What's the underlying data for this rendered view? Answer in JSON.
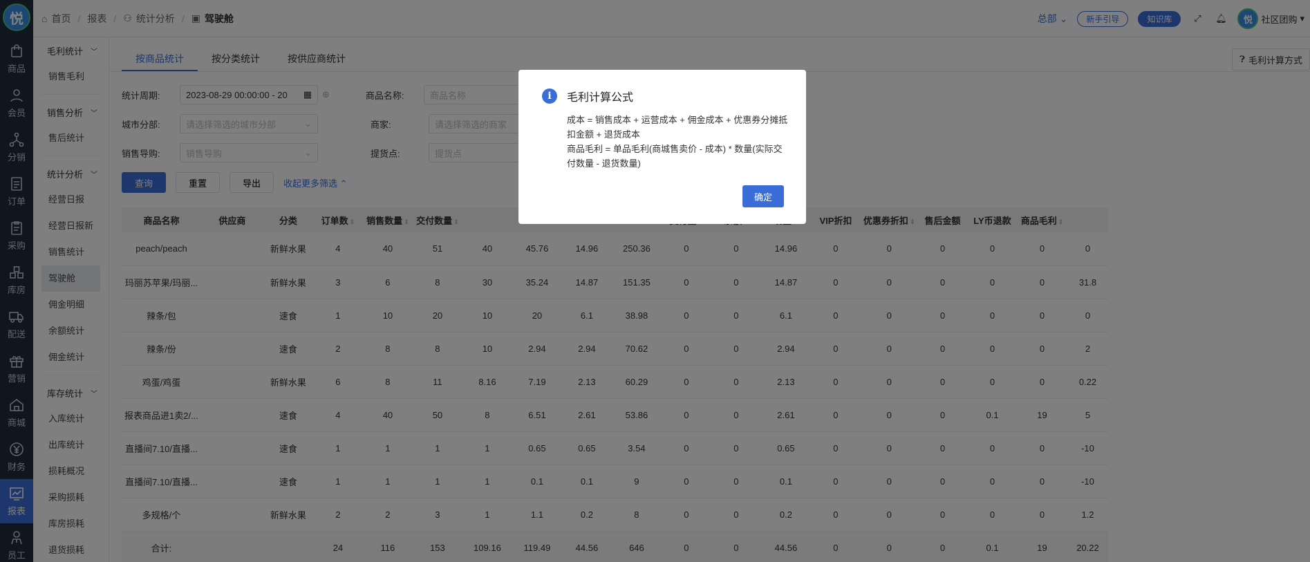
{
  "sidebar": {
    "logo": "悦",
    "items": [
      {
        "label": "商品",
        "icon": "bag-icon"
      },
      {
        "label": "会员",
        "icon": "user-icon"
      },
      {
        "label": "分销",
        "icon": "network-icon"
      },
      {
        "label": "订单",
        "icon": "document-icon"
      },
      {
        "label": "采购",
        "icon": "clipboard-icon"
      },
      {
        "label": "库房",
        "icon": "boxes-icon"
      },
      {
        "label": "配送",
        "icon": "truck-icon"
      },
      {
        "label": "营销",
        "icon": "gift-icon"
      },
      {
        "label": "商城",
        "icon": "home-icon"
      },
      {
        "label": "财务",
        "icon": "yen-icon"
      },
      {
        "label": "报表",
        "icon": "chart-icon"
      },
      {
        "label": "员工",
        "icon": "staff-icon"
      }
    ]
  },
  "submenu": {
    "group1": "毛利统计",
    "g1_items": [
      "销售毛利"
    ],
    "group2": "销售分析",
    "g2_items": [
      "售后统计"
    ],
    "group3": "统计分析",
    "g3_items": [
      "经营日报",
      "经营日报新",
      "销售统计",
      "驾驶舱",
      "佣金明细",
      "余额统计",
      "佣金统计"
    ],
    "group4": "库存统计",
    "g4_items": [
      "入库统计",
      "出库统计",
      "损耗概况",
      "采购损耗",
      "库房损耗",
      "退货损耗"
    ]
  },
  "header": {
    "breadcrumb": [
      "首页",
      "报表",
      "统计分析",
      "驾驶舱"
    ],
    "org": "总部",
    "guide": "新手引导",
    "kb": "知识库",
    "user": "社区团购",
    "avatar": "悦"
  },
  "tabs": [
    "按商品统计",
    "按分类统计",
    "按供应商统计"
  ],
  "calc_button": "毛利计算方式",
  "filters": {
    "period_label": "统计周期:",
    "period_value": "2023-08-29 00:00:00 - 20",
    "product_label": "商品名称:",
    "product_ph": "商品名称",
    "city_label": "城市分部:",
    "city_ph": "请选择筛选的城市分部",
    "merchant_label": "商家:",
    "merchant_ph": "请选择筛选的商家",
    "guide_label": "销售导购:",
    "guide_ph": "销售导购",
    "pickup_label": "提货点:",
    "pickup_ph": "提货点"
  },
  "buttons": {
    "query": "查询",
    "reset": "重置",
    "export": "导出",
    "more": "收起更多筛选"
  },
  "table": {
    "headers": [
      "商品名称",
      "供应商",
      "分类",
      "订单数",
      "销售数量",
      "交付数量",
      "",
      "",
      "",
      "",
      "支付宝",
      "余额",
      "现金",
      "VIP折扣",
      "优惠券折扣",
      "售后金额",
      "LY币退款",
      "商品毛利"
    ],
    "sortable": [
      false,
      false,
      false,
      true,
      true,
      true,
      false,
      false,
      false,
      false,
      true,
      true,
      true,
      false,
      true,
      false,
      false,
      true
    ],
    "rows": [
      [
        "peach/peach",
        "",
        "新鲜水果",
        "4",
        "40",
        "51",
        "40",
        "45.76",
        "14.96",
        "250.36",
        "0",
        "0",
        "14.96",
        "0",
        "0",
        "0",
        "0",
        "0",
        "0"
      ],
      [
        "玛丽苏苹果/玛丽...",
        "",
        "新鲜水果",
        "3",
        "6",
        "8",
        "30",
        "35.24",
        "14.87",
        "151.35",
        "0",
        "0",
        "14.87",
        "0",
        "0",
        "0",
        "0",
        "0",
        "31.8"
      ],
      [
        "辣条/包",
        "",
        "速食",
        "1",
        "10",
        "20",
        "10",
        "20",
        "6.1",
        "38.98",
        "0",
        "0",
        "6.1",
        "0",
        "0",
        "0",
        "0",
        "0",
        "0"
      ],
      [
        "辣条/份",
        "",
        "速食",
        "2",
        "8",
        "8",
        "10",
        "2.94",
        "2.94",
        "70.62",
        "0",
        "0",
        "2.94",
        "0",
        "0",
        "0",
        "0",
        "0",
        "2"
      ],
      [
        "鸡蛋/鸡蛋",
        "",
        "新鲜水果",
        "6",
        "8",
        "11",
        "8.16",
        "7.19",
        "2.13",
        "60.29",
        "0",
        "0",
        "2.13",
        "0",
        "0",
        "0",
        "0",
        "0",
        "0.22"
      ],
      [
        "报表商品进1卖2/...",
        "",
        "速食",
        "4",
        "40",
        "50",
        "8",
        "6.51",
        "2.61",
        "53.86",
        "0",
        "0",
        "2.61",
        "0",
        "0",
        "0",
        "0.1",
        "19",
        "5"
      ],
      [
        "直播间7.10/直播...",
        "",
        "速食",
        "1",
        "1",
        "1",
        "1",
        "0.65",
        "0.65",
        "3.54",
        "0",
        "0",
        "0.65",
        "0",
        "0",
        "0",
        "0",
        "0",
        "-10"
      ],
      [
        "直播间7.10/直播...",
        "",
        "速食",
        "1",
        "1",
        "1",
        "1",
        "0.1",
        "0.1",
        "9",
        "0",
        "0",
        "0.1",
        "0",
        "0",
        "0",
        "0",
        "0",
        "-10"
      ],
      [
        "多规格/个",
        "",
        "新鲜水果",
        "2",
        "2",
        "3",
        "1",
        "1.1",
        "0.2",
        "8",
        "0",
        "0",
        "0.2",
        "0",
        "0",
        "0",
        "0",
        "0",
        "1.2"
      ]
    ],
    "total": [
      "合计:",
      "",
      "",
      "24",
      "116",
      "153",
      "109.16",
      "119.49",
      "44.56",
      "646",
      "0",
      "0",
      "44.56",
      "0",
      "0",
      "0",
      "0.1",
      "19",
      "20.22"
    ]
  },
  "dialog": {
    "title": "毛利计算公式",
    "line1": "成本 = 销售成本 + 运营成本 + 佣金成本 + 优惠券分摊抵扣金额 + 退货成本",
    "line2": "商品毛利 = 单品毛利(商城售卖价 - 成本) * 数量(实际交付数量 - 退货数量)",
    "ok": "确定"
  }
}
